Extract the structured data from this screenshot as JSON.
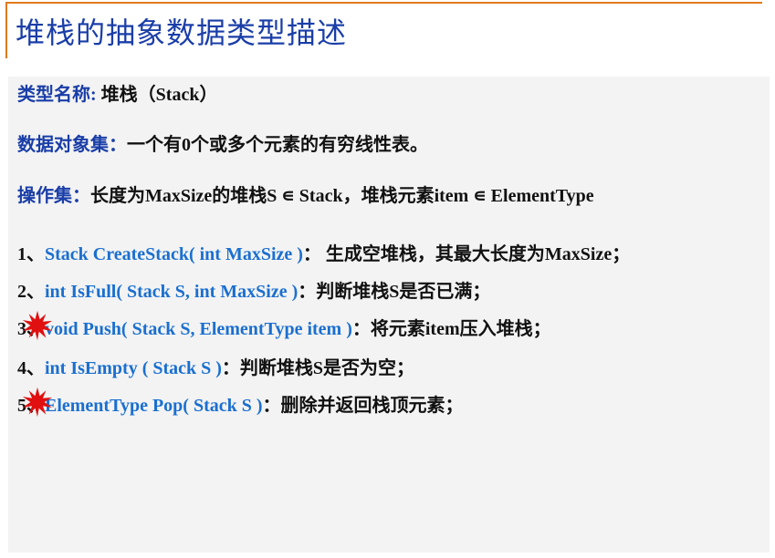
{
  "slide": {
    "title": "堆栈的抽象数据类型描述"
  },
  "type_name": {
    "label": "类型名称:",
    "value": " 堆栈（Stack）"
  },
  "data_set": {
    "label": "数据对象集：",
    "value": "一个有0个或多个元素的有穷线性表。"
  },
  "operations": {
    "label": "操作集：",
    "value": "长度为MaxSize的堆栈S ∊ Stack，堆栈元素item ∊ ElementType"
  },
  "ops_list": [
    {
      "num": "1",
      "sep": "、",
      "signature": "Stack CreateStack( int MaxSize )",
      "desc": "：  生成空堆栈，其最大长度为MaxSize；"
    },
    {
      "num": "2",
      "sep": "、",
      "signature": "int IsFull( Stack S, int MaxSize )",
      "desc": "：判断堆栈S是否已满；"
    },
    {
      "num": "3",
      "sep": "、",
      "signature": "void Push( Stack S, ElementType item )",
      "desc": "：将元素item压入堆栈；"
    },
    {
      "num": "4",
      "sep": "、",
      "signature": "int IsEmpty ( Stack S )",
      "desc": "：判断堆栈S是否为空；"
    },
    {
      "num": "5",
      "sep": "、",
      "signature": "ElementType Pop( Stack S )",
      "desc": "：删除并返回栈顶元素；"
    }
  ],
  "colors": {
    "title": "#1a3ea8",
    "label": "#1a3ea8",
    "signature": "#1a6fd0",
    "accent_rule": "#e07a1c",
    "starburst": "#e01010",
    "panel": "#f3f3f3"
  },
  "icons": {
    "important_marker": "red-starburst-icon"
  }
}
